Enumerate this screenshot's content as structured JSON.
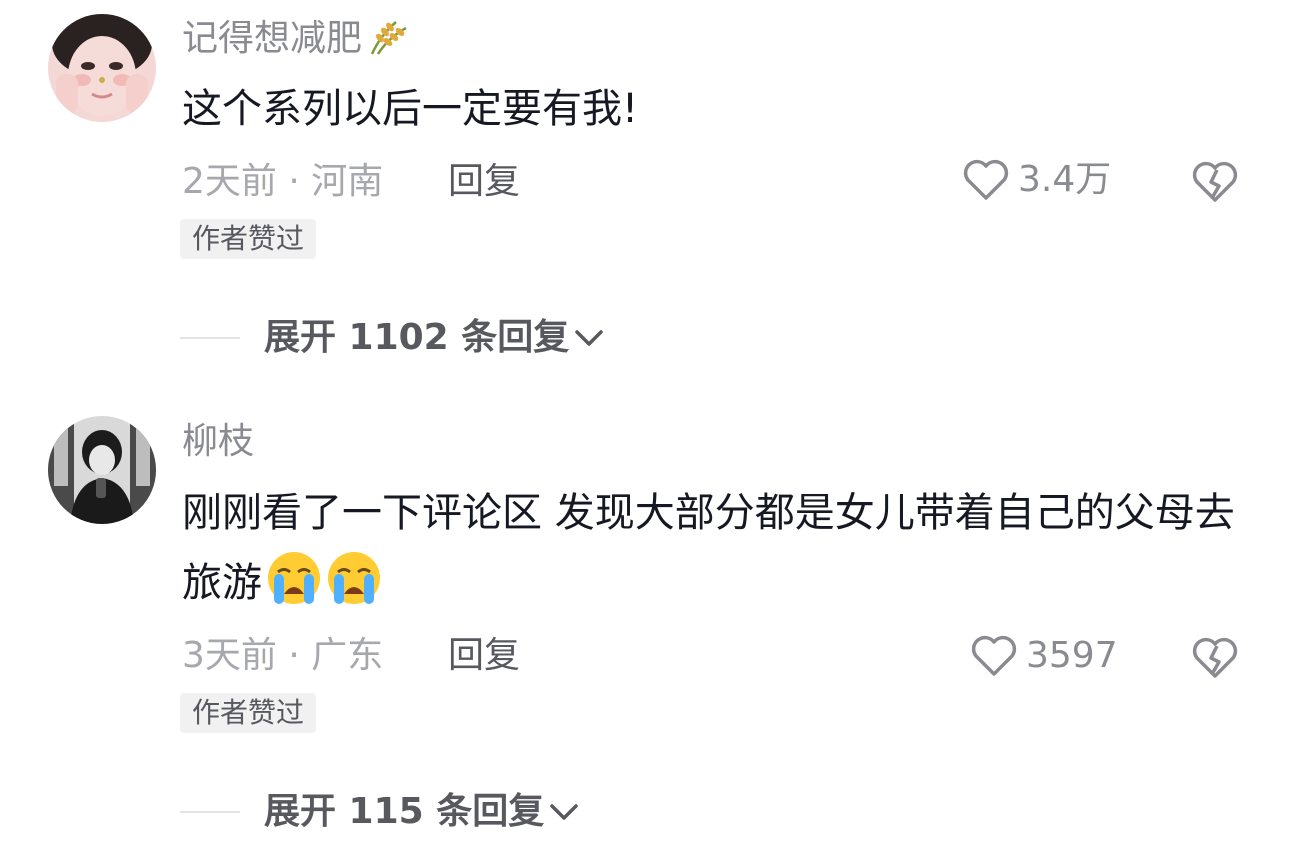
{
  "comments": [
    {
      "username": "记得想减肥",
      "username_icon": "rice-ear-icon",
      "content": "这个系列以后一定要有我!",
      "emojis": [],
      "meta": "2天前 · 河南",
      "reply_label": "回复",
      "likes": "3.4万",
      "badge": "作者赞过",
      "expand_label": "展开 1102 条回复"
    },
    {
      "username": "柳枝",
      "content": "刚刚看了一下评论区 发现大部分都是女儿带着自己的父母去旅游",
      "emojis": [
        "loudly-crying-face-emoji",
        "loudly-crying-face-emoji"
      ],
      "meta": "3天前 · 广东",
      "reply_label": "回复",
      "likes": "3597",
      "badge": "作者赞过",
      "expand_label": "展开 115 条回复"
    }
  ],
  "colors": {
    "text_primary": "#161823",
    "text_secondary": "#8a8b91",
    "text_meta": "#a7a8ad",
    "badge_bg": "#f1f1f2"
  }
}
